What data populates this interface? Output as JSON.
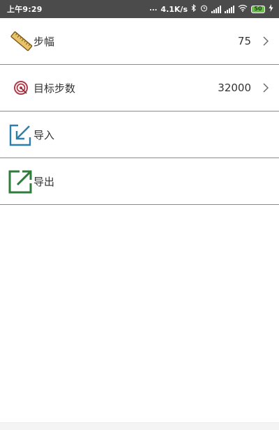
{
  "status_bar": {
    "time": "上午9:29",
    "dots": "...",
    "network_speed": "4.1K/s",
    "battery_level": "50",
    "icons": [
      "bluetooth-icon",
      "alarm-icon",
      "signal-icon",
      "signal-icon",
      "wifi-icon",
      "battery-icon",
      "charging-icon"
    ]
  },
  "settings": {
    "items": [
      {
        "label": "步幅",
        "value": "75",
        "icon": "ruler-icon",
        "has_chevron": true
      },
      {
        "label": "目标步数",
        "value": "32000",
        "icon": "target-icon",
        "has_chevron": true
      },
      {
        "label": "导入",
        "value": "",
        "icon": "import-icon",
        "has_chevron": false
      },
      {
        "label": "导出",
        "value": "",
        "icon": "export-icon",
        "has_chevron": false
      }
    ]
  },
  "colors": {
    "status_bar_bg": "#4b4b4b",
    "divider": "#8a8a8a",
    "ruler": "#e8c36a",
    "target": "#b03a4a",
    "import": "#2b7fa8",
    "export": "#2e7d3a",
    "battery": "#6cc04a"
  }
}
